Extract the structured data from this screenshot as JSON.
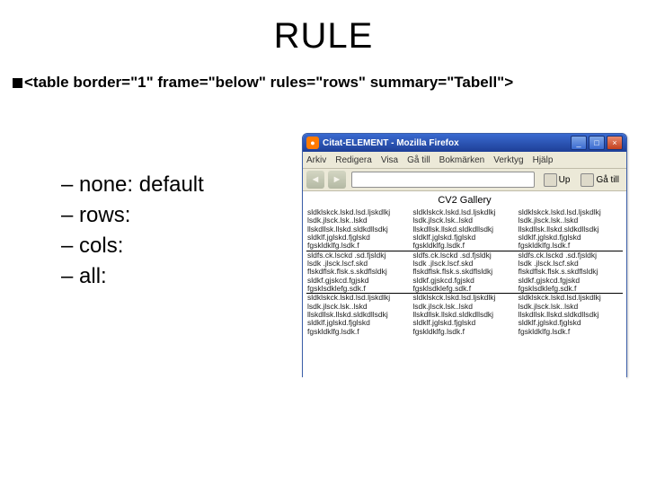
{
  "title": "RULE",
  "code_line": "<table border=\"1\"  frame=\"below\" rules=\"rows\" summary=\"Tabell\">",
  "bullets": [
    "– none: default",
    "– rows:",
    "– cols:",
    "– all:"
  ],
  "browser": {
    "window_title": "Citat-ELEMENT - Mozilla Firefox",
    "menu": [
      "Arkiv",
      "Redigera",
      "Visa",
      "Gå till",
      "Bokmärken",
      "Verktyg",
      "Hjälp"
    ],
    "toolbar": {
      "up_label": "Up",
      "go_label": "Gå till"
    },
    "page_title": "CV2 Gallery",
    "cell_lines": [
      "sldklskck.lskd.lsd.ljskdlkj",
      "lsdk.jlsck.lsk..lskd",
      "llskdllsk.llskd.sldkdllsdkj",
      "sldklf.jglskd.fjglskd",
      "fgskldklfg.lsdk.f"
    ],
    "cell_lines_b": [
      "sldfs.ck.lsckd .sd.fjsldkj",
      "lsdk .jlsck.lscf.skd",
      "flskdflsk.flsk.s.skdflsldkj",
      "sldkf.gjskcd.fgjskd",
      "fgsklsdklefg.sdk.f"
    ]
  }
}
